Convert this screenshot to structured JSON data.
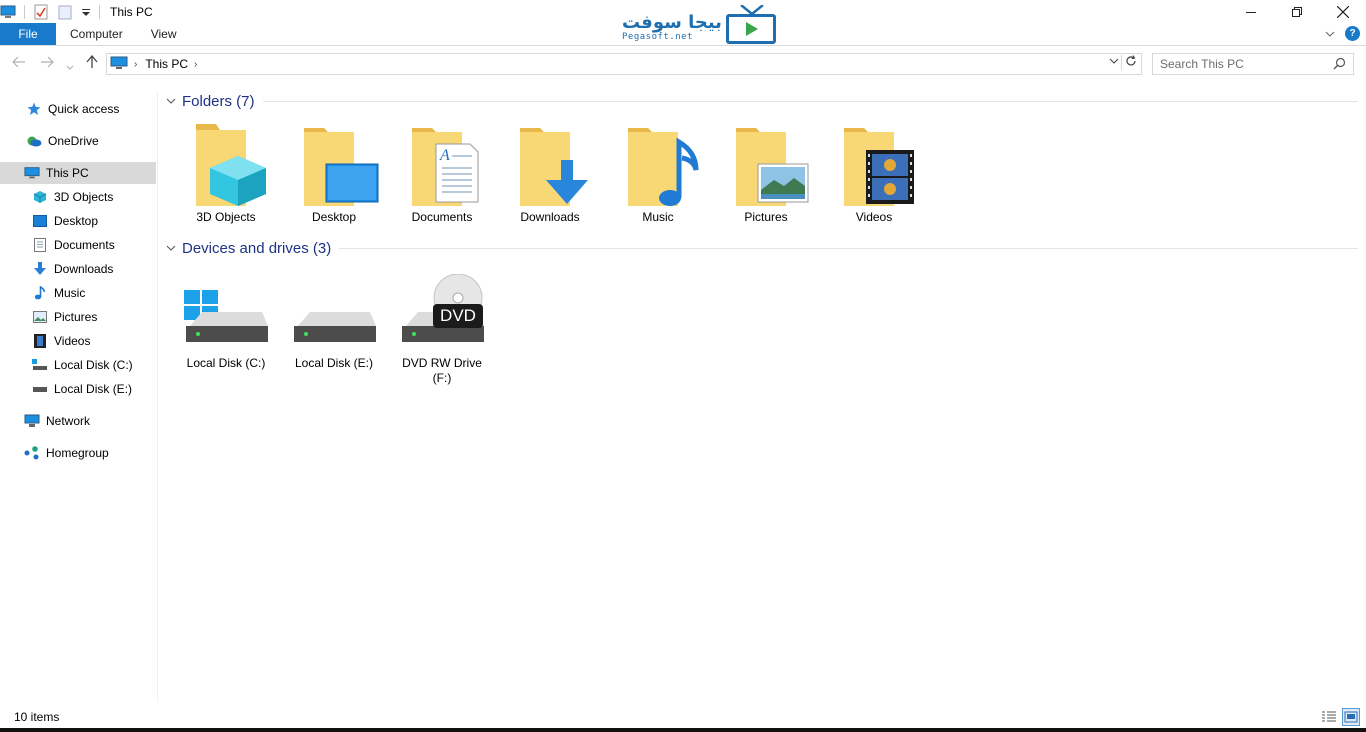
{
  "window": {
    "title": "This PC",
    "controls": [
      "minimize",
      "restore",
      "close"
    ]
  },
  "logo": {
    "arabic_text": "بيجا سوفت",
    "latin_text": "Pegasoft.net"
  },
  "ribbon": {
    "tabs": [
      {
        "label": "File",
        "active": true
      },
      {
        "label": "Computer"
      },
      {
        "label": "View"
      }
    ],
    "help_label": "?"
  },
  "address": {
    "crumb": "This PC",
    "search_placeholder": "Search This PC"
  },
  "sidebar": {
    "items": [
      {
        "label": "Quick access",
        "icon": "star-icon",
        "level": 0
      },
      {
        "label": "OneDrive",
        "icon": "onedrive-icon",
        "level": 0
      },
      {
        "label": "This PC",
        "icon": "pc-icon",
        "level": 0,
        "selected": true
      },
      {
        "label": "3D Objects",
        "icon": "cube-icon",
        "level": 1
      },
      {
        "label": "Desktop",
        "icon": "desktop-icon",
        "level": 1
      },
      {
        "label": "Documents",
        "icon": "document-icon",
        "level": 1
      },
      {
        "label": "Downloads",
        "icon": "download-icon",
        "level": 1
      },
      {
        "label": "Music",
        "icon": "music-icon",
        "level": 1
      },
      {
        "label": "Pictures",
        "icon": "picture-icon",
        "level": 1
      },
      {
        "label": "Videos",
        "icon": "video-icon",
        "level": 1
      },
      {
        "label": "Local Disk (C:)",
        "icon": "drive-c-icon",
        "level": 1
      },
      {
        "label": "Local Disk (E:)",
        "icon": "drive-icon",
        "level": 1
      },
      {
        "label": "Network",
        "icon": "network-icon",
        "level": 0
      },
      {
        "label": "Homegroup",
        "icon": "homegroup-icon",
        "level": 0
      }
    ]
  },
  "folders": {
    "header": "Folders (7)",
    "items": [
      {
        "label": "3D Objects",
        "icon": "cube-folder-icon"
      },
      {
        "label": "Desktop",
        "icon": "desktop-folder-icon"
      },
      {
        "label": "Documents",
        "icon": "documents-folder-icon"
      },
      {
        "label": "Downloads",
        "icon": "downloads-folder-icon"
      },
      {
        "label": "Music",
        "icon": "music-folder-icon"
      },
      {
        "label": "Pictures",
        "icon": "pictures-folder-icon"
      },
      {
        "label": "Videos",
        "icon": "videos-folder-icon"
      }
    ]
  },
  "drives": {
    "header": "Devices and drives (3)",
    "items": [
      {
        "label": "Local Disk (C:)",
        "icon": "system-drive-icon"
      },
      {
        "label": "Local Disk (E:)",
        "icon": "hard-drive-icon"
      },
      {
        "label": "DVD RW Drive (F:)",
        "icon": "dvd-drive-icon",
        "badge": "DVD"
      }
    ]
  },
  "status": {
    "item_count": "10 items"
  },
  "colors": {
    "accent": "#1979ca",
    "folder": "#f8d775",
    "group_title": "#1e3287"
  }
}
